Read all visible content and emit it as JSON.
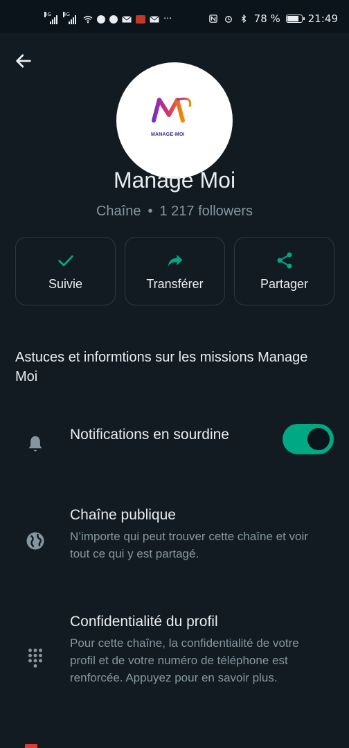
{
  "status_bar": {
    "network_1": "4G",
    "network_2": "4G",
    "more": "···",
    "battery": "78 %",
    "time": "21:49"
  },
  "channel": {
    "logo_text": "MANAGE-MOI",
    "name": "Manage Moi",
    "type": "Chaîne",
    "separator": "•",
    "followers": "1 217 followers",
    "description": "Astuces et informtions sur les missions Manage Moi"
  },
  "actions": [
    {
      "label": "Suivie",
      "icon": "check-icon"
    },
    {
      "label": "Transférer",
      "icon": "forward-icon"
    },
    {
      "label": "Partager",
      "icon": "share-icon"
    }
  ],
  "settings": {
    "mute": {
      "label": "Notifications en sourdine",
      "icon": "bell-icon",
      "enabled": true
    },
    "public": {
      "label": "Chaîne publique",
      "description": "N’importe qui peut trouver cette chaîne et voir tout ce qui y est partagé.",
      "icon": "globe-icon"
    },
    "privacy": {
      "label": "Confidentialité du profil",
      "description": "Pour cette chaîne, la confidentialité de votre profil et de votre numéro de téléphone est renforcée. Appuyez pour en savoir plus.",
      "icon": "dialpad-icon"
    }
  },
  "colors": {
    "accent": "#00a884",
    "background": "#121b22",
    "text_secondary": "#8696a0"
  }
}
